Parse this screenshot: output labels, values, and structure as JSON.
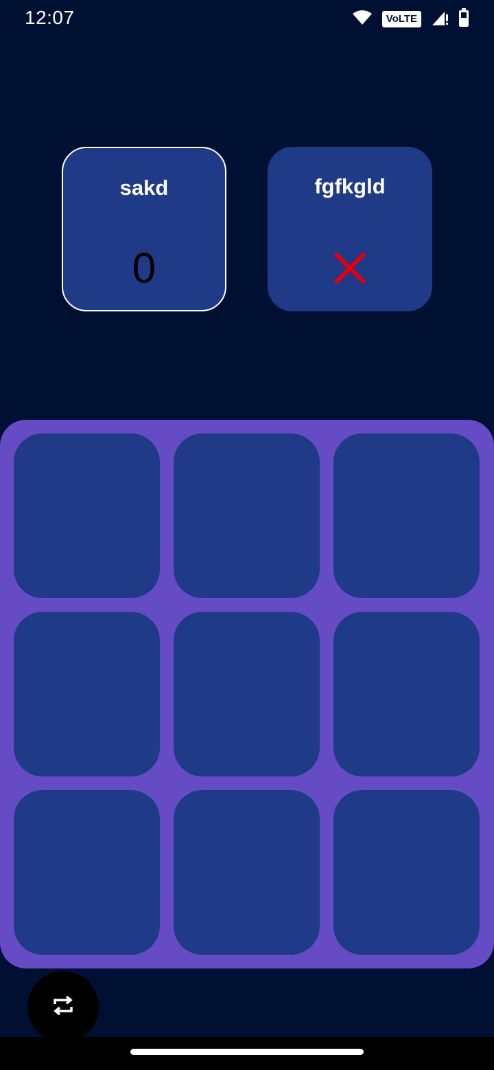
{
  "status_bar": {
    "time": "12:07",
    "network_badge": "VoLTE",
    "icons": [
      "wifi-icon",
      "volte-icon",
      "signal-icon",
      "battery-icon"
    ]
  },
  "players": [
    {
      "name": "sakd",
      "mark": "0",
      "active": true
    },
    {
      "name": "fgfkgld",
      "mark": "x-icon",
      "mark_color": "#e8000b",
      "active": false
    }
  ],
  "board": {
    "rows": 3,
    "cols": 3,
    "cells": [
      "",
      "",
      "",
      "",
      "",
      "",
      "",
      "",
      ""
    ]
  },
  "fab": {
    "icon": "switch-arrows-icon"
  },
  "colors": {
    "background": "#001033",
    "card": "#1f3a87",
    "board": "#654bc4",
    "x_mark": "#e8000b"
  }
}
